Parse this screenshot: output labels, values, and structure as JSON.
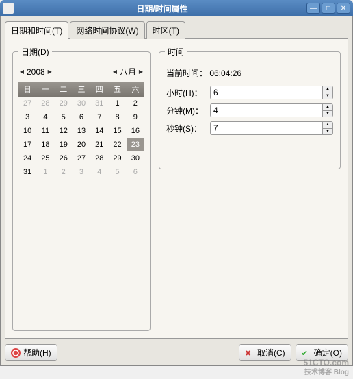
{
  "window": {
    "title": "日期/时间属性"
  },
  "tabs": {
    "date_time": "日期和时间(T)",
    "ntp": "网络时间协议(W)",
    "tz": "时区(T)"
  },
  "date": {
    "legend": "日期(D)",
    "year": "2008",
    "month": "八月",
    "weekdays": [
      "日",
      "一",
      "二",
      "三",
      "四",
      "五",
      "六"
    ],
    "grid": [
      [
        {
          "d": 27,
          "o": true
        },
        {
          "d": 28,
          "o": true
        },
        {
          "d": 29,
          "o": true
        },
        {
          "d": 30,
          "o": true
        },
        {
          "d": 31,
          "o": true
        },
        {
          "d": 1
        },
        {
          "d": 2
        }
      ],
      [
        {
          "d": 3
        },
        {
          "d": 4
        },
        {
          "d": 5
        },
        {
          "d": 6
        },
        {
          "d": 7
        },
        {
          "d": 8
        },
        {
          "d": 9
        }
      ],
      [
        {
          "d": 10
        },
        {
          "d": 11
        },
        {
          "d": 12
        },
        {
          "d": 13
        },
        {
          "d": 14
        },
        {
          "d": 15
        },
        {
          "d": 16
        }
      ],
      [
        {
          "d": 17
        },
        {
          "d": 18
        },
        {
          "d": 19
        },
        {
          "d": 20
        },
        {
          "d": 21
        },
        {
          "d": 22
        },
        {
          "d": 23,
          "sel": true
        }
      ],
      [
        {
          "d": 24
        },
        {
          "d": 25
        },
        {
          "d": 26
        },
        {
          "d": 27
        },
        {
          "d": 28
        },
        {
          "d": 29
        },
        {
          "d": 30
        }
      ],
      [
        {
          "d": 31
        },
        {
          "d": 1,
          "o": true
        },
        {
          "d": 2,
          "o": true
        },
        {
          "d": 3,
          "o": true
        },
        {
          "d": 4,
          "o": true
        },
        {
          "d": 5,
          "o": true
        },
        {
          "d": 6,
          "o": true
        }
      ]
    ]
  },
  "time": {
    "legend": "时间",
    "current_label": "当前时间：",
    "current_value": "06:04:26",
    "hour_label": "小时(H)：",
    "hour_value": "6",
    "minute_label": "分钟(M)：",
    "minute_value": "4",
    "second_label": "秒钟(S)：",
    "second_value": "7"
  },
  "footer": {
    "help": "帮助(H)",
    "cancel": "取消(C)",
    "ok": "确定(O)"
  },
  "watermark": {
    "main": "51CTO.com",
    "sub": "技术博客 Blog"
  }
}
